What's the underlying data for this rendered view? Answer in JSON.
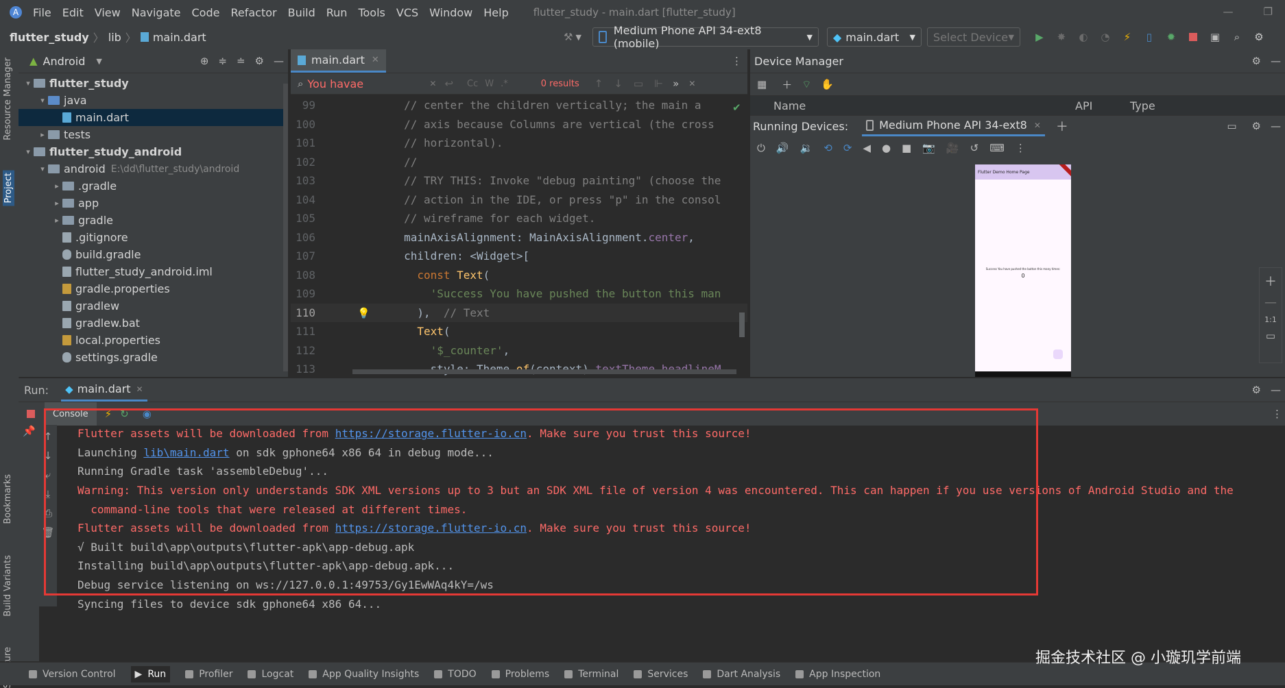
{
  "menubar": {
    "items": [
      "File",
      "Edit",
      "View",
      "Navigate",
      "Code",
      "Refactor",
      "Build",
      "Run",
      "Tools",
      "VCS",
      "Window",
      "Help"
    ],
    "window_title": "flutter_study - main.dart [flutter_study]"
  },
  "navbar": {
    "breadcrumb": [
      "flutter_study",
      "lib",
      "main.dart"
    ],
    "device_combo": "Medium Phone API 34-ext8 (mobile)",
    "config_combo": "main.dart",
    "select_device": "Select Device"
  },
  "left_stripe": {
    "resource_manager": "Resource Manager",
    "project": "Project",
    "bookmarks": "Bookmarks",
    "build_variants": "Build Variants",
    "structure": "Structure"
  },
  "project": {
    "view": "Android",
    "tree": [
      {
        "label": "flutter_study",
        "indent": 0,
        "arrow": "▾",
        "icon": "folder",
        "bold": true
      },
      {
        "label": "java",
        "indent": 1,
        "arrow": "▾",
        "icon": "folder-blue"
      },
      {
        "label": "main.dart",
        "indent": 2,
        "arrow": "",
        "icon": "dart",
        "selected": true
      },
      {
        "label": "tests",
        "indent": 1,
        "arrow": "▸",
        "icon": "folder"
      },
      {
        "label": "flutter_study_android",
        "indent": 0,
        "arrow": "▾",
        "icon": "folder",
        "bold": true
      },
      {
        "label": "android",
        "indent": 1,
        "arrow": "▾",
        "icon": "folder",
        "path": "E:\\dd\\flutter_study\\android"
      },
      {
        "label": ".gradle",
        "indent": 2,
        "arrow": "▸",
        "icon": "folder"
      },
      {
        "label": "app",
        "indent": 2,
        "arrow": "▸",
        "icon": "folder"
      },
      {
        "label": "gradle",
        "indent": 2,
        "arrow": "▸",
        "icon": "folder"
      },
      {
        "label": ".gitignore",
        "indent": 2,
        "arrow": "",
        "icon": "file"
      },
      {
        "label": "build.gradle",
        "indent": 2,
        "arrow": "",
        "icon": "gradle"
      },
      {
        "label": "flutter_study_android.iml",
        "indent": 2,
        "arrow": "",
        "icon": "file"
      },
      {
        "label": "gradle.properties",
        "indent": 2,
        "arrow": "",
        "icon": "props"
      },
      {
        "label": "gradlew",
        "indent": 2,
        "arrow": "",
        "icon": "file"
      },
      {
        "label": "gradlew.bat",
        "indent": 2,
        "arrow": "",
        "icon": "file"
      },
      {
        "label": "local.properties",
        "indent": 2,
        "arrow": "",
        "icon": "props"
      },
      {
        "label": "settings.gradle",
        "indent": 2,
        "arrow": "",
        "icon": "gradle"
      }
    ]
  },
  "editor": {
    "tab": "main.dart",
    "find_query": "You havae",
    "find_results": "0 results",
    "lines": [
      {
        "n": "99",
        "parts": [
          [
            "cm",
            "        // center the children vertically; the main a"
          ]
        ]
      },
      {
        "n": "100",
        "parts": [
          [
            "cm",
            "        // axis because Columns are vertical (the cross"
          ]
        ]
      },
      {
        "n": "101",
        "parts": [
          [
            "cm",
            "        // horizontal)."
          ]
        ]
      },
      {
        "n": "102",
        "parts": [
          [
            "cm",
            "        //"
          ]
        ]
      },
      {
        "n": "103",
        "parts": [
          [
            "cm",
            "        // TRY THIS: Invoke \"debug painting\" (choose the"
          ]
        ]
      },
      {
        "n": "104",
        "parts": [
          [
            "cm",
            "        // action in the IDE, or press \"p\" in the consol"
          ]
        ]
      },
      {
        "n": "105",
        "parts": [
          [
            "cm",
            "        // wireframe for each widget."
          ]
        ]
      },
      {
        "n": "106",
        "parts": [
          [
            "pl",
            "        mainAxisAlignment: MainAxisAlignment."
          ],
          [
            "prop",
            "center"
          ],
          [
            "pl",
            ","
          ]
        ]
      },
      {
        "n": "107",
        "parts": [
          [
            "pl",
            "        children: <Widget>["
          ]
        ]
      },
      {
        "n": "108",
        "parts": [
          [
            "kw",
            "          const "
          ],
          [
            "fn",
            "Text"
          ],
          [
            "pl",
            "("
          ]
        ]
      },
      {
        "n": "109",
        "parts": [
          [
            "str",
            "            'Success You have pushed the button this man"
          ]
        ]
      },
      {
        "n": "110",
        "parts": [
          [
            "pl",
            "          ),  "
          ],
          [
            "cm",
            "// Text"
          ]
        ]
      },
      {
        "n": "111",
        "parts": [
          [
            "fn",
            "          Text"
          ],
          [
            "pl",
            "("
          ]
        ]
      },
      {
        "n": "112",
        "parts": [
          [
            "str",
            "            '$_counter'"
          ],
          [
            "pl",
            ","
          ]
        ]
      },
      {
        "n": "113",
        "parts": [
          [
            "pl",
            "            style: Theme."
          ],
          [
            "fn",
            "of"
          ],
          [
            "pl",
            "(context)."
          ],
          [
            "prop",
            "textTheme"
          ],
          [
            "pl",
            "."
          ],
          [
            "prop",
            "headlineM"
          ]
        ]
      }
    ]
  },
  "device": {
    "title": "Device Manager",
    "columns": [
      "Name",
      "API",
      "Type"
    ],
    "running_label": "Running Devices:",
    "running_tab": "Medium Phone API 34-ext8",
    "phone_appbar": "Flutter Demo Home Page",
    "phone_text": "Success You have pushed the button this many times:",
    "phone_counter": "0",
    "zoom_ratio": "1:1"
  },
  "run": {
    "label": "Run:",
    "tab": "main.dart",
    "console_tab": "Console",
    "lines": [
      {
        "parts": [
          [
            "red",
            "Flutter assets will be downloaded from "
          ],
          [
            "link",
            "https://storage.flutter-io.cn"
          ],
          [
            "red",
            ". Make sure you trust this source!"
          ]
        ]
      },
      {
        "parts": [
          [
            "gray",
            "Launching "
          ],
          [
            "link",
            "lib\\main.dart"
          ],
          [
            "gray",
            " on sdk gphone64 x86 64 in debug mode..."
          ]
        ]
      },
      {
        "parts": [
          [
            "gray",
            "Running Gradle task 'assembleDebug'..."
          ]
        ]
      },
      {
        "parts": [
          [
            "red",
            "Warning: This version only understands SDK XML versions up to 3 but an SDK XML file of version 4 was encountered. This can happen if you use versions of Android Studio and the"
          ]
        ]
      },
      {
        "parts": [
          [
            "red",
            "  command-line tools that were released at different times."
          ]
        ]
      },
      {
        "parts": [
          [
            "red",
            "Flutter assets will be downloaded from "
          ],
          [
            "link",
            "https://storage.flutter-io.cn"
          ],
          [
            "red",
            ". Make sure you trust this source!"
          ]
        ]
      },
      {
        "parts": [
          [
            "gray",
            "√ Built build\\app\\outputs\\flutter-apk\\app-debug.apk"
          ]
        ]
      },
      {
        "parts": [
          [
            "gray",
            "Installing build\\app\\outputs\\flutter-apk\\app-debug.apk..."
          ]
        ]
      },
      {
        "parts": [
          [
            "gray",
            "Debug service listening on ws://127.0.0.1:49753/Gy1EwWAq4kY=/ws"
          ]
        ]
      },
      {
        "parts": [
          [
            "gray",
            "Syncing files to device sdk gphone64 x86 64..."
          ]
        ]
      }
    ]
  },
  "bottombar": {
    "items": [
      "Version Control",
      "Run",
      "Profiler",
      "Logcat",
      "App Quality Insights",
      "TODO",
      "Problems",
      "Terminal",
      "Services",
      "Dart Analysis",
      "App Inspection"
    ]
  },
  "watermark": "掘金技术社区 @ 小璇玑学前端",
  "colors": {
    "highlight_box": "#e53935",
    "accent": "#4a88c7"
  }
}
